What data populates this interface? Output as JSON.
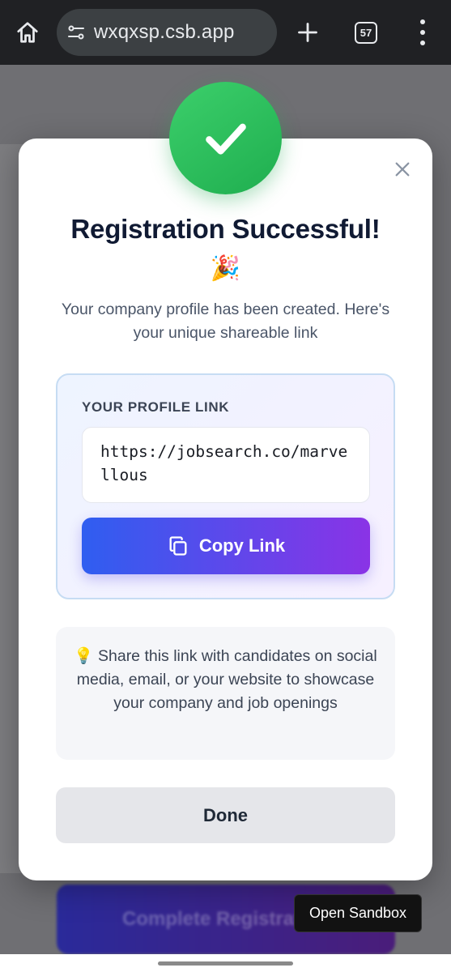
{
  "browser": {
    "url": "wxqxsp.csb.app",
    "tab_count": "57",
    "icons": [
      "home-icon",
      "site-settings-icon",
      "plus-icon",
      "tab-switcher-icon",
      "more-vert-icon"
    ]
  },
  "background": {
    "button_label": "Complete Registration"
  },
  "modal": {
    "title": "Registration Successful!",
    "emoji": "🎉",
    "subtitle": "Your company profile has been created. Here's your unique shareable link",
    "link_section": {
      "label": "YOUR PROFILE LINK",
      "url": "https://jobsearch.co/marvellous",
      "copy_label": "Copy Link"
    },
    "tip": "💡 Share this link with candidates on social media, email, or your website to showcase your company and job openings",
    "done_label": "Done"
  },
  "sandbox_button": {
    "label": "Open Sandbox"
  },
  "colors": {
    "success_green": "#22c55e",
    "gradient_start": "#2f5ef0",
    "gradient_end": "#8a33e6",
    "title": "#101a33"
  }
}
